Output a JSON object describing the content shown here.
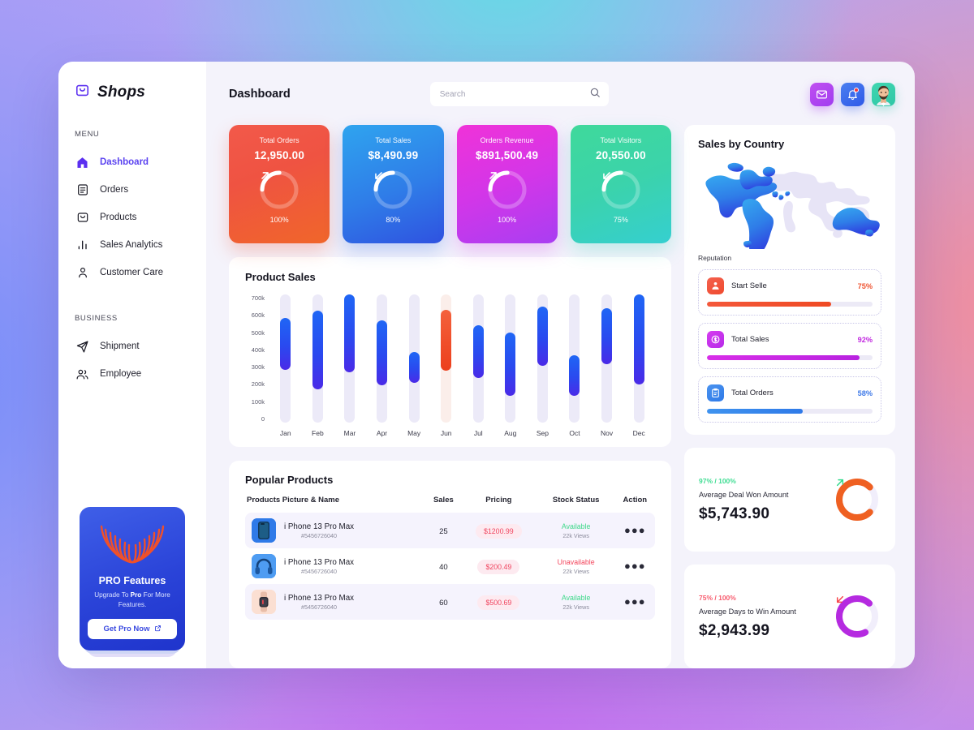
{
  "brand": {
    "name": "Shops",
    "icon": "shopping-bag-icon"
  },
  "sidebar": {
    "menu_label": "MENU",
    "business_label": "BUSINESS",
    "menu_items": [
      {
        "label": "Dashboard",
        "icon": "home-icon",
        "active": true
      },
      {
        "label": "Orders",
        "icon": "orders-list-icon",
        "active": false
      },
      {
        "label": "Products",
        "icon": "products-bag-icon",
        "active": false
      },
      {
        "label": "Sales Analytics",
        "icon": "bar-chart-icon",
        "active": false
      },
      {
        "label": "Customer Care",
        "icon": "user-icon",
        "active": false
      }
    ],
    "business_items": [
      {
        "label": "Shipment",
        "icon": "send-plane-icon",
        "active": false
      },
      {
        "label": "Employee",
        "icon": "users-group-icon",
        "active": false
      }
    ],
    "promo": {
      "title": "PRO Features",
      "subtitle_pre": "Upgrade To ",
      "subtitle_bold": "Pro",
      "subtitle_post": " For More Features.",
      "button": "Get Pro Now",
      "button_icon": "external-link-icon"
    }
  },
  "header": {
    "title": "Dashboard",
    "search_placeholder": "Search",
    "search_value": "",
    "search_icon": "search-icon",
    "icons": [
      {
        "name": "mail-icon"
      },
      {
        "name": "bell-icon",
        "has_dot": true
      },
      {
        "name": "avatar"
      }
    ]
  },
  "stats": [
    {
      "label": "Total Orders",
      "value": "12,950.00",
      "pct": "100%",
      "pct_num": 100,
      "trend": "up",
      "theme": "c1"
    },
    {
      "label": "Total Sales",
      "value": "$8,490.99",
      "pct": "80%",
      "pct_num": 80,
      "trend": "down",
      "theme": "c2"
    },
    {
      "label": "Orders Revenue",
      "value": "$891,500.49",
      "pct": "100%",
      "pct_num": 100,
      "trend": "up",
      "theme": "c3"
    },
    {
      "label": "Total Visitors",
      "value": "20,550.00",
      "pct": "75%",
      "pct_num": 75,
      "trend": "down",
      "theme": "c4"
    }
  ],
  "chart_data": {
    "type": "bar",
    "title": "Product Sales",
    "xlabel": "",
    "ylabel": "",
    "ylim": [
      0,
      700000
    ],
    "grid": false,
    "legend": "none",
    "ytick_labels": [
      "700k",
      "600k",
      "500k",
      "400k",
      "300k",
      "200k",
      "100k",
      "0"
    ],
    "ytick_values": [
      700000,
      600000,
      500000,
      400000,
      300000,
      200000,
      100000,
      0
    ],
    "categories": [
      "Jan",
      "Feb",
      "Mar",
      "Apr",
      "May",
      "Jun",
      "Jul",
      "Aug",
      "Sep",
      "Oct",
      "Nov",
      "Dec"
    ],
    "series": [
      {
        "name": "Product Sales",
        "note": "Each bar is a floating range bar: value spans from 'low' to 'high'.",
        "low": [
          290000,
          180000,
          275000,
          205000,
          215000,
          285000,
          245000,
          145000,
          310000,
          145000,
          320000,
          210000
        ],
        "high": [
          570000,
          610000,
          700000,
          560000,
          385000,
          615000,
          530000,
          490000,
          635000,
          370000,
          625000,
          700000
        ],
        "highlight_index": 5,
        "highlight_color": "#ef4a23",
        "bar_color": "#3b3bf0"
      }
    ]
  },
  "products": {
    "title": "Popular Products",
    "columns": [
      "Products Picture & Name",
      "Sales",
      "Pricing",
      "Stock Status",
      "Action"
    ],
    "rows": [
      {
        "name": "i Phone 13 Pro Max",
        "sku": "#5456726040",
        "sales": "25",
        "price": "$1200.99",
        "stock": "Available",
        "views": "22k Views",
        "thumb": "phone-thumbnail",
        "thumb_class": "t1",
        "stock_ok": true
      },
      {
        "name": "i Phone 13 Pro Max",
        "sku": "#5456726040",
        "sales": "40",
        "price": "$200.49",
        "stock": "Unavailable",
        "views": "22k Views",
        "thumb": "headphones-thumbnail",
        "thumb_class": "t2",
        "stock_ok": false
      },
      {
        "name": "i Phone 13 Pro Max",
        "sku": "#5456726040",
        "sales": "60",
        "price": "$500.69",
        "stock": "Available",
        "views": "22k Views",
        "thumb": "watch-thumbnail",
        "thumb_class": "t3",
        "stock_ok": true
      }
    ],
    "action_icon": "more-dots-icon"
  },
  "country": {
    "title": "Sales by Country",
    "map_icon": "world-map",
    "reputation_label": "Reputation",
    "items": [
      {
        "name": "Start Selle",
        "pct": "75%",
        "pct_num": 75,
        "icon": "seller-badge-icon",
        "theme": "1"
      },
      {
        "name": "Total Sales",
        "pct": "92%",
        "pct_num": 92,
        "icon": "dollar-badge-icon",
        "theme": "2"
      },
      {
        "name": "Total Orders",
        "pct": "58%",
        "pct_num": 58,
        "icon": "clipboard-badge-icon",
        "theme": "3"
      }
    ]
  },
  "kpis": [
    {
      "pct": "97% / 100%",
      "pct_num": 97,
      "pct_theme": "g",
      "name": "Average Deal Won Amount",
      "value": "$5,743.90",
      "ring_color": "#ef6021",
      "arrow": "up",
      "arrow_color": "#2fd98a"
    },
    {
      "pct": "75% / 100%",
      "pct_num": 75,
      "pct_theme": "r",
      "name": "Average Days to Win Amount",
      "value": "$2,943.99",
      "ring_color": "#b52ae0",
      "arrow": "down",
      "arrow_color": "#f7454a"
    }
  ]
}
